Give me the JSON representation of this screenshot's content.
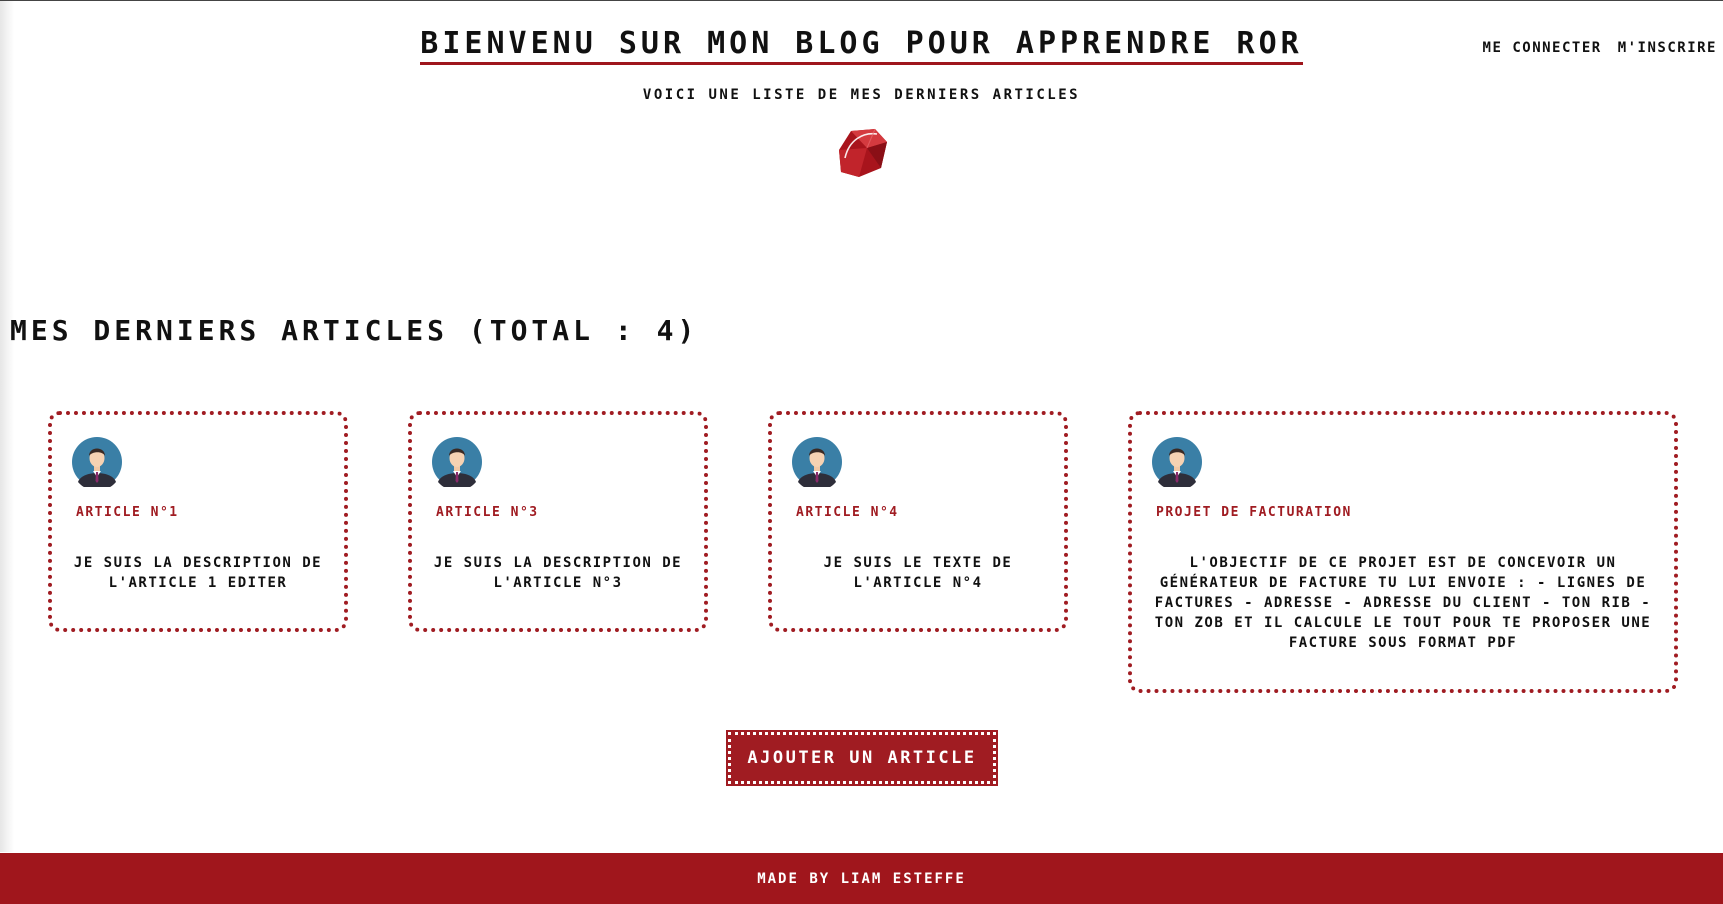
{
  "header": {
    "title": "Bienvenu sur mon blog pour apprendre RoR",
    "subtitle": "Voici une liste de mes derniers articles",
    "login_label": "Me connecter",
    "signup_label": "M'inscrire"
  },
  "section": {
    "title": "Mes derniers articles (Total : 4)"
  },
  "articles": [
    {
      "title": "Article n°1",
      "description": "Je suis la description de l'article 1 editer",
      "avatar_icon": "user-avatar-icon"
    },
    {
      "title": "Article n°3",
      "description": "Je suis la description de l'article n°3",
      "avatar_icon": "user-avatar-icon"
    },
    {
      "title": "Article n°4",
      "description": "Je suis le texte de l'article n°4",
      "avatar_icon": "user-avatar-icon"
    },
    {
      "title": "Projet de facturation",
      "description": "L'objectif de ce projet est de concevoir un générateur de facture tu lui envoie : - Lignes de factures - Adresse - Adresse du client - Ton RIB - Ton zob et il calcule le tout pour te proposer une facture sous format pdf",
      "avatar_icon": "user-avatar-icon"
    }
  ],
  "actions": {
    "add_article_label": "Ajouter un article"
  },
  "footer": {
    "text": "Made by Liam Esteffe"
  },
  "colors": {
    "accent": "#a01c22",
    "footer_bg": "#a0161c",
    "text": "#111111",
    "background": "#ffffff"
  }
}
